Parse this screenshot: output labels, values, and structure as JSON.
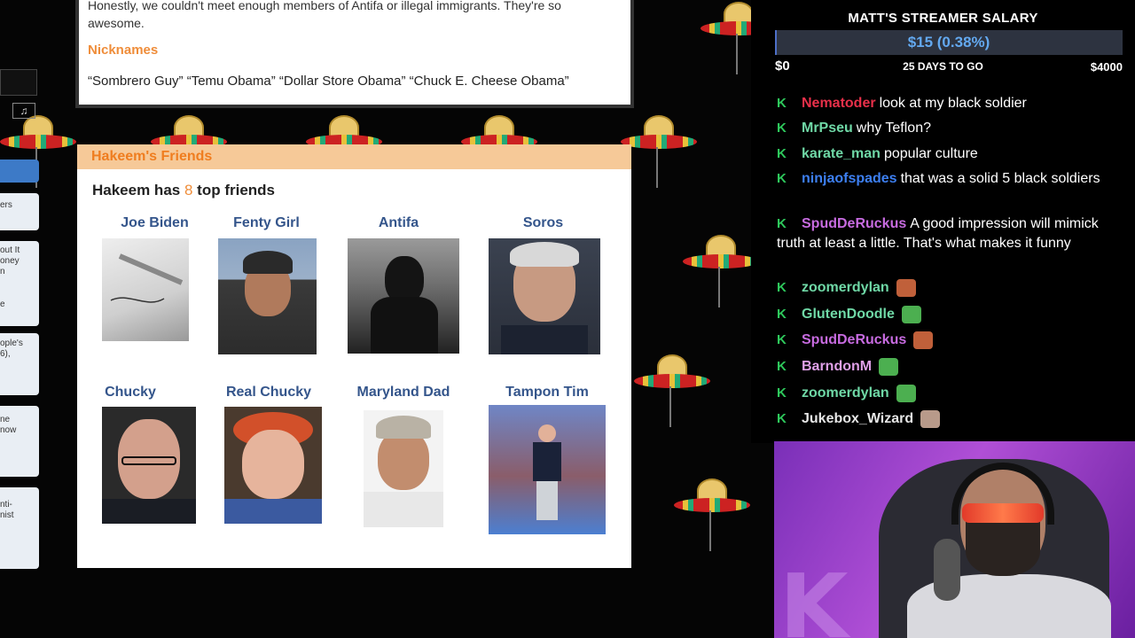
{
  "card": {
    "quote": "Honestly, we couldn't meet enough members of Antifa or illegal immigrants. They're so awesome.",
    "nicknames_title": "Nicknames",
    "nicknames": "“Sombrero Guy” “Temu Obama” “Dollar Store Obama”  “Chuck E. Cheese Obama”"
  },
  "friends": {
    "header": "Hakeem's Friends",
    "count_prefix": "Hakeem has",
    "count": "8",
    "count_suffix": "top friends",
    "items": [
      {
        "name": "Joe Biden"
      },
      {
        "name": "Fenty Girl"
      },
      {
        "name": "Antifa"
      },
      {
        "name": "Soros"
      },
      {
        "name": "Chucky"
      },
      {
        "name": "Real Chucky"
      },
      {
        "name": "Maryland Dad"
      },
      {
        "name": "Tampon Tim"
      }
    ]
  },
  "left_app": {
    "snippets": [
      "ers",
      "out It\noney\nn",
      "e",
      "ople's\n6),",
      "ne\nnow",
      "nti-\nnist"
    ]
  },
  "salary": {
    "title": "MATT'S STREAMER SALARY",
    "amount": "$15 (0.38%)",
    "progress_fraction": 0.0038,
    "low": "$0",
    "days": "25 DAYS TO GO",
    "high": "$4000"
  },
  "chat": {
    "messages": [
      {
        "user": "Nematoder",
        "color": "#e8304a",
        "text": "look at my black soldier"
      },
      {
        "user": "MrPseu",
        "color": "#6fd8a6",
        "text": "why Teflon?"
      },
      {
        "user": "karate_man",
        "color": "#6fd8a6",
        "text": "popular culture"
      },
      {
        "user": "ninjaofspades",
        "color": "#3d7ff0",
        "text": "that was a solid 5 black soldiers"
      },
      {
        "user": "SpudDeRuckus",
        "color": "#c76be0",
        "text": "A good impression will mimick truth at least a little. That's what makes it funny"
      },
      {
        "user": "zoomerdylan",
        "color": "#6fd8a6",
        "text": ""
      },
      {
        "user": "GlutenDoodle",
        "color": "#6fd8a6",
        "text": ""
      },
      {
        "user": "SpudDeRuckus",
        "color": "#c76be0",
        "text": ""
      },
      {
        "user": "BarndonM",
        "color": "#e0a0e8",
        "text": ""
      },
      {
        "user": "zoomerdylan",
        "color": "#6fd8a6",
        "text": ""
      },
      {
        "user": "Jukebox_Wizard",
        "color": "#e6e6e6",
        "text": ""
      }
    ],
    "badge": "K",
    "emote_colors": [
      "#c0603a",
      "#4caf50",
      "#c0603a",
      "#4caf50",
      "#4caf50",
      "#b89a8a"
    ]
  },
  "colors": {
    "accent_orange": "#ef8d3a",
    "friend_name_blue": "#34558b",
    "chat_badge_green": "#2ec95c",
    "webcam_purple": "#9b3fcf"
  }
}
